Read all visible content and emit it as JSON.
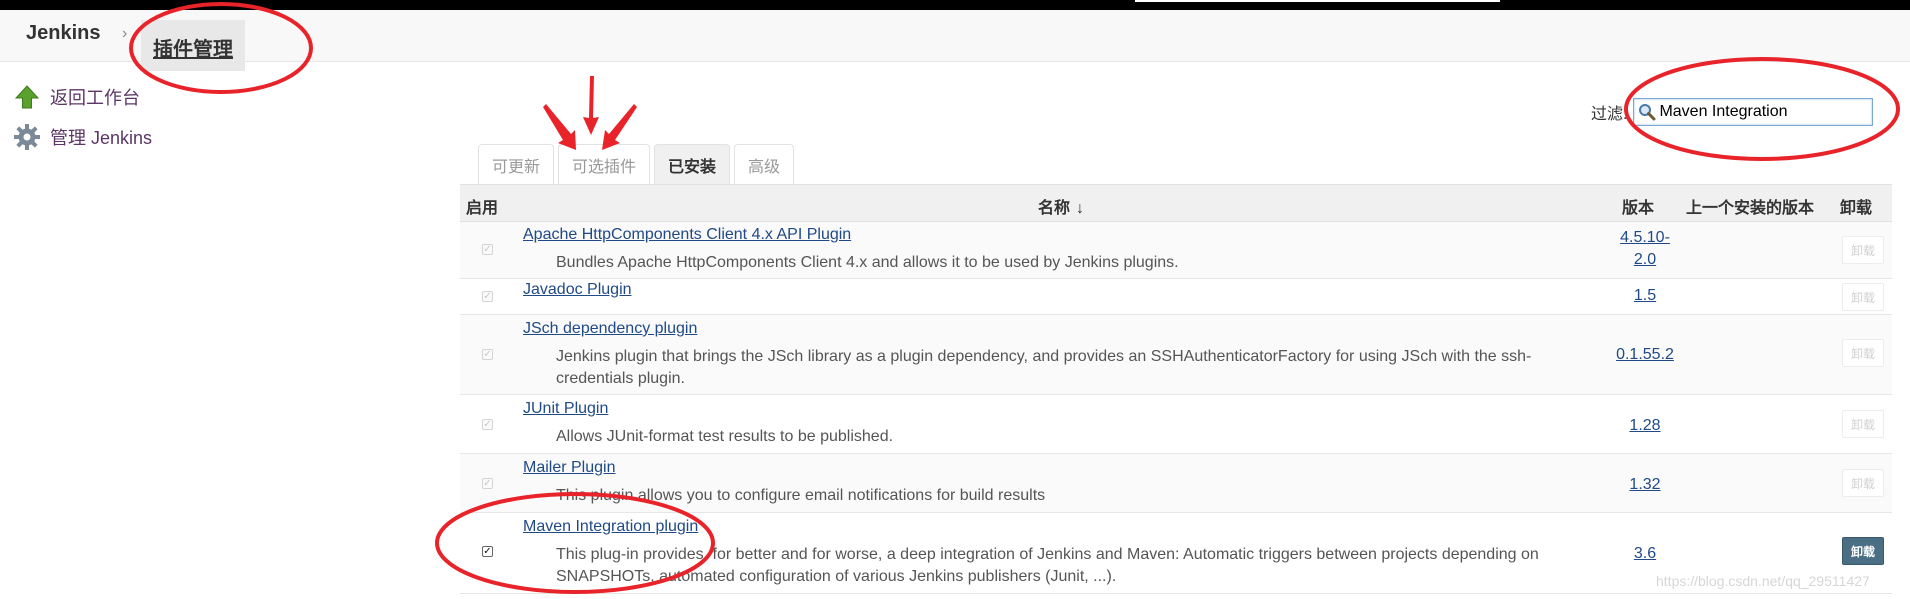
{
  "breadcrumb": {
    "home": "Jenkins",
    "separator": "›",
    "current": "插件管理"
  },
  "sidebar": {
    "items": [
      {
        "label": "返回工作台",
        "icon": "up-arrow-icon"
      },
      {
        "label": "管理 Jenkins",
        "icon": "gear-icon"
      }
    ]
  },
  "filter": {
    "label": "过滤:",
    "value": "Maven Integration"
  },
  "tabs": [
    {
      "label": "可更新",
      "active": false
    },
    {
      "label": "可选插件",
      "active": false
    },
    {
      "label": "已安装",
      "active": true
    },
    {
      "label": "高级",
      "active": false
    }
  ],
  "table": {
    "headers": {
      "enabled": "启用",
      "name": "名称",
      "sort": "↓",
      "version": "版本",
      "previous": "上一个安装的版本",
      "uninstall": "卸载"
    },
    "rows": [
      {
        "name": "Apache HttpComponents Client 4.x API Plugin",
        "description": "Bundles Apache HttpComponents Client 4.x and allows it to be used by Jenkins plugins.",
        "version": "4.5.10-2.0",
        "enabled": true,
        "disabled_checkbox": true,
        "uninstall": "卸载"
      },
      {
        "name": "Javadoc Plugin",
        "description": "",
        "version": "1.5",
        "enabled": true,
        "disabled_checkbox": true,
        "uninstall": "卸载"
      },
      {
        "name": "JSch dependency plugin",
        "description": "Jenkins plugin that brings the JSch library as a plugin dependency, and provides an SSHAuthenticatorFactory for using JSch with the ssh-credentials plugin.",
        "version": "0.1.55.2",
        "enabled": true,
        "disabled_checkbox": true,
        "uninstall": "卸载"
      },
      {
        "name": "JUnit Plugin",
        "description": "Allows JUnit-format test results to be published.",
        "version": "1.28",
        "enabled": true,
        "disabled_checkbox": true,
        "uninstall": "卸载"
      },
      {
        "name": "Mailer Plugin",
        "description": "This plugin allows you to configure email notifications for build results",
        "version": "1.32",
        "enabled": true,
        "disabled_checkbox": true,
        "uninstall": "卸载"
      },
      {
        "name": "Maven Integration plugin",
        "description": "This plug-in provides, for better and for worse, a deep integration of Jenkins and Maven: Automatic triggers between projects depending on SNAPSHOTs, automated configuration of various Jenkins publishers (Junit, ...).",
        "version": "3.6",
        "enabled": true,
        "disabled_checkbox": false,
        "uninstall": "卸载"
      }
    ]
  },
  "watermark": "https://blog.csdn.net/qq_29511427",
  "colors": {
    "annotation": "#e8232a",
    "link": "#204a87",
    "uninstall_active": "#4a6f85"
  }
}
